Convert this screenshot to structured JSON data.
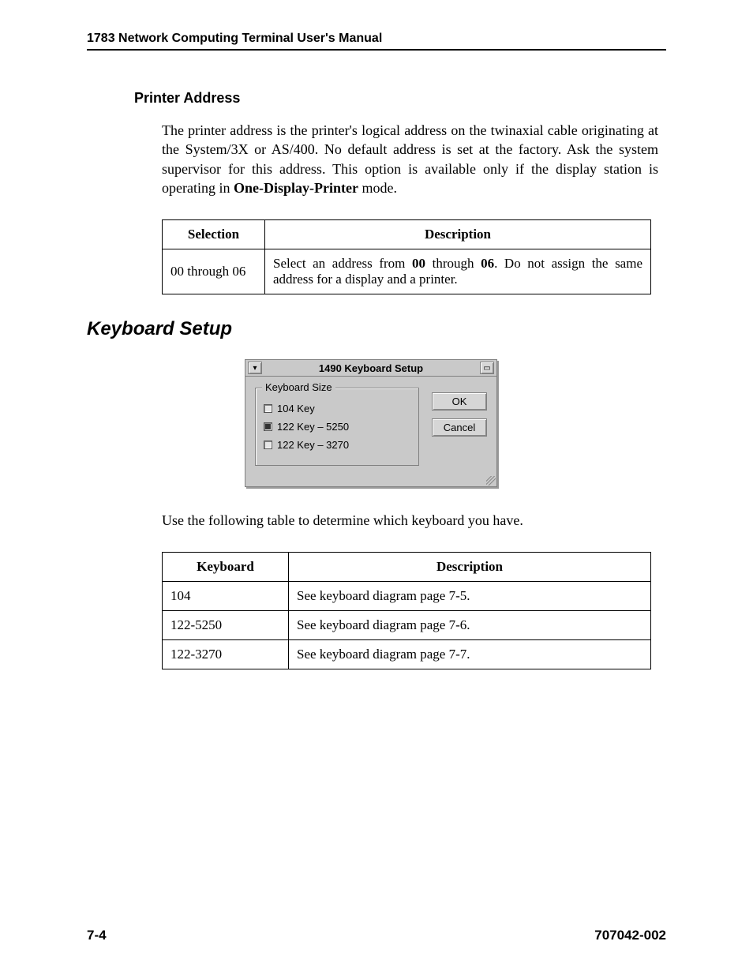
{
  "header": "1783 Network Computing Terminal User's Manual",
  "sections": {
    "printer_address": {
      "title": "Printer Address",
      "para_pre": "The printer address is the printer's logical address on the twinaxial cable originating at the System/3X or AS/400. No default address is set at the factory. Ask the system supervisor for this address. This option is available only if the display station is operating in ",
      "para_bold": "One-Display-Printer",
      "para_post": " mode."
    },
    "keyboard_setup": {
      "title": "Keyboard Setup",
      "followup": "Use the following table to determine which keyboard you have."
    }
  },
  "table1": {
    "headers": {
      "col1": "Selection",
      "col2": "Description"
    },
    "row": {
      "selection": "00 through 06",
      "desc_pre": "Select an address from ",
      "desc_b1": "00",
      "desc_mid": " through ",
      "desc_b2": "06",
      "desc_post": ".  Do not assign the same address for a display and a printer."
    }
  },
  "dialog": {
    "title": "1490 Keyboard Setup",
    "group_label": "Keyboard Size",
    "options": {
      "opt1": "104 Key",
      "opt2": "122 Key – 5250",
      "opt3": "122 Key – 3270"
    },
    "buttons": {
      "ok": "OK",
      "cancel": "Cancel"
    }
  },
  "table2": {
    "headers": {
      "col1": "Keyboard",
      "col2": "Description"
    },
    "rows": [
      {
        "kbd": "104",
        "desc": "See keyboard diagram page 7-5."
      },
      {
        "kbd": "122-5250",
        "desc": "See keyboard diagram page 7-6."
      },
      {
        "kbd": "122-3270",
        "desc": "See keyboard diagram page 7-7."
      }
    ]
  },
  "footer": {
    "page": "7-4",
    "docnum": "707042-002"
  }
}
